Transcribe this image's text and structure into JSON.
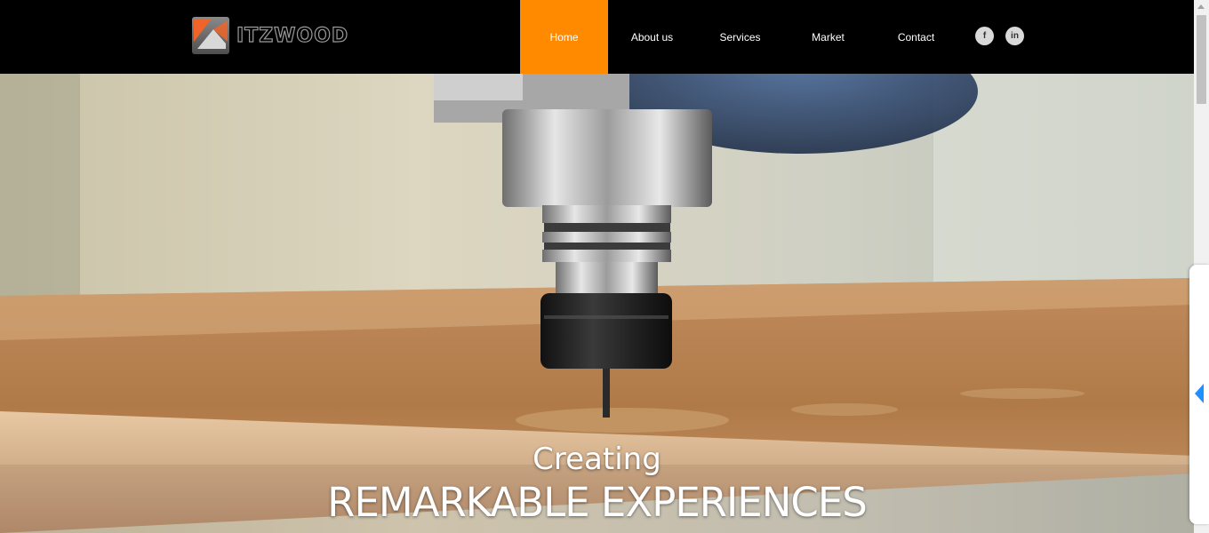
{
  "brand": {
    "name": "ITZWOOD",
    "accent_color": "#ff8a00"
  },
  "nav": {
    "items": [
      {
        "label": "Home",
        "active": true
      },
      {
        "label": "About us",
        "active": false
      },
      {
        "label": "Services",
        "active": false
      },
      {
        "label": "Market",
        "active": false
      },
      {
        "label": "Contact",
        "active": false
      }
    ]
  },
  "social": [
    {
      "icon": "facebook-icon",
      "glyph": "f"
    },
    {
      "icon": "linkedin-icon",
      "glyph": "in"
    }
  ],
  "hero": {
    "subtitle": "Creating",
    "title": "REMARKABLE EXPERIENCES",
    "image": "cnc-router-cutting-wood-photo"
  },
  "side_panel": {
    "icon": "chevron-left-icon",
    "arrow_color": "#1e90ff"
  }
}
